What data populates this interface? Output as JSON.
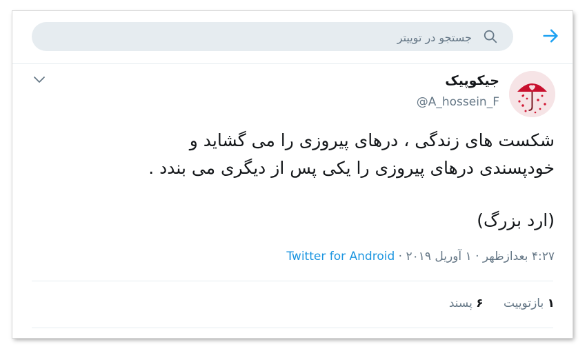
{
  "search": {
    "placeholder": "جستجو در توییتر",
    "back_icon": "arrow-right-icon",
    "search_icon": "search-icon"
  },
  "tweet": {
    "author": {
      "display_name": "جیکوپیک",
      "handle": "@A_hossein_F",
      "avatar_icon": "umbrella-hearts-avatar"
    },
    "text_lines": [
      "شکست های زندگی ، درهای پیروزی را می گشاید و",
      "خودپسندی درهای پیروزی را یکی پس از دیگری می بندد ."
    ],
    "attribution": "(ارد بزرگ)",
    "time": "۴:۲۷ بعدازظهر",
    "date": "۱ آوریل ۲۰۱۹",
    "separator": "·",
    "source": "Twitter for Android",
    "retweets": {
      "count": "۱",
      "label": "بازتوییت"
    },
    "likes": {
      "count": "۶",
      "label": "پسند"
    }
  },
  "colors": {
    "accent": "#1da1f2",
    "link": "#1b95e0",
    "text": "#14171a",
    "secondary": "#657786",
    "search_bg": "#e6ecf0"
  }
}
